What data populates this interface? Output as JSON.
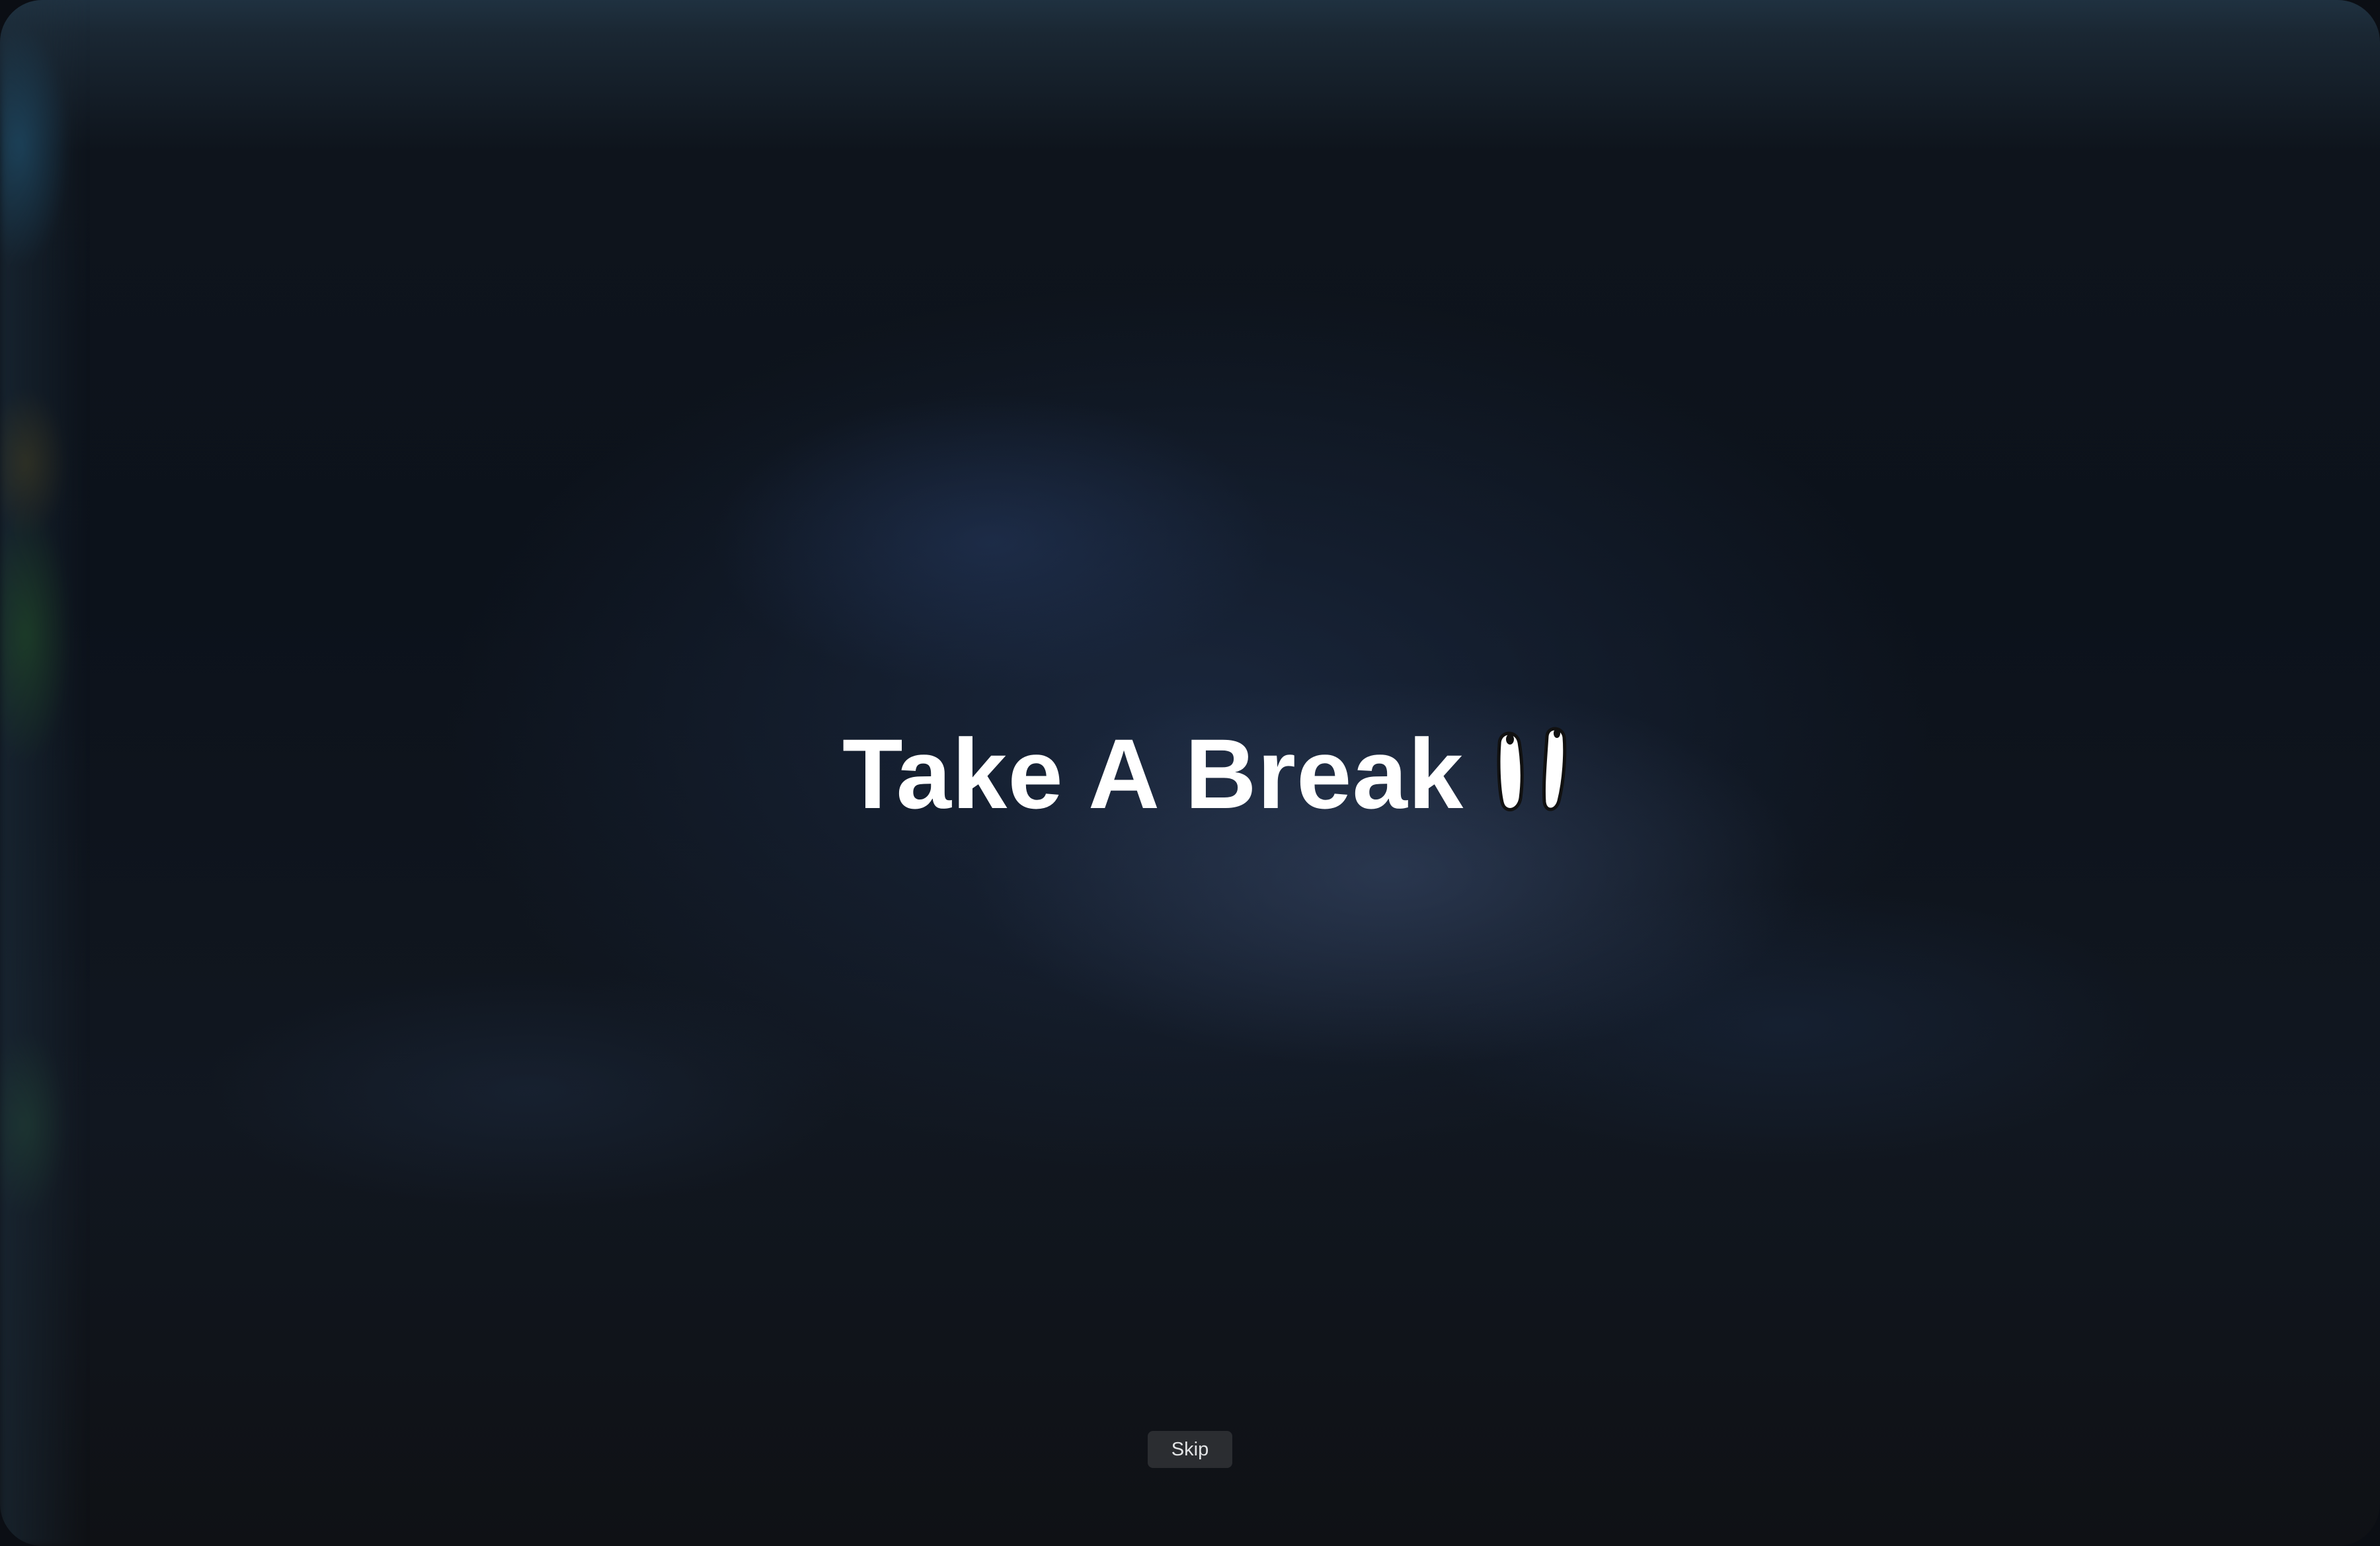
{
  "break_screen": {
    "title": "Take A Break",
    "icon": "footprints-icon",
    "skip_label": "Skip"
  },
  "colors": {
    "background": "#0c121b",
    "title": "#ffffff",
    "skip_button_bg": "#2b2d31",
    "skip_button_text": "#e3e4e6"
  }
}
